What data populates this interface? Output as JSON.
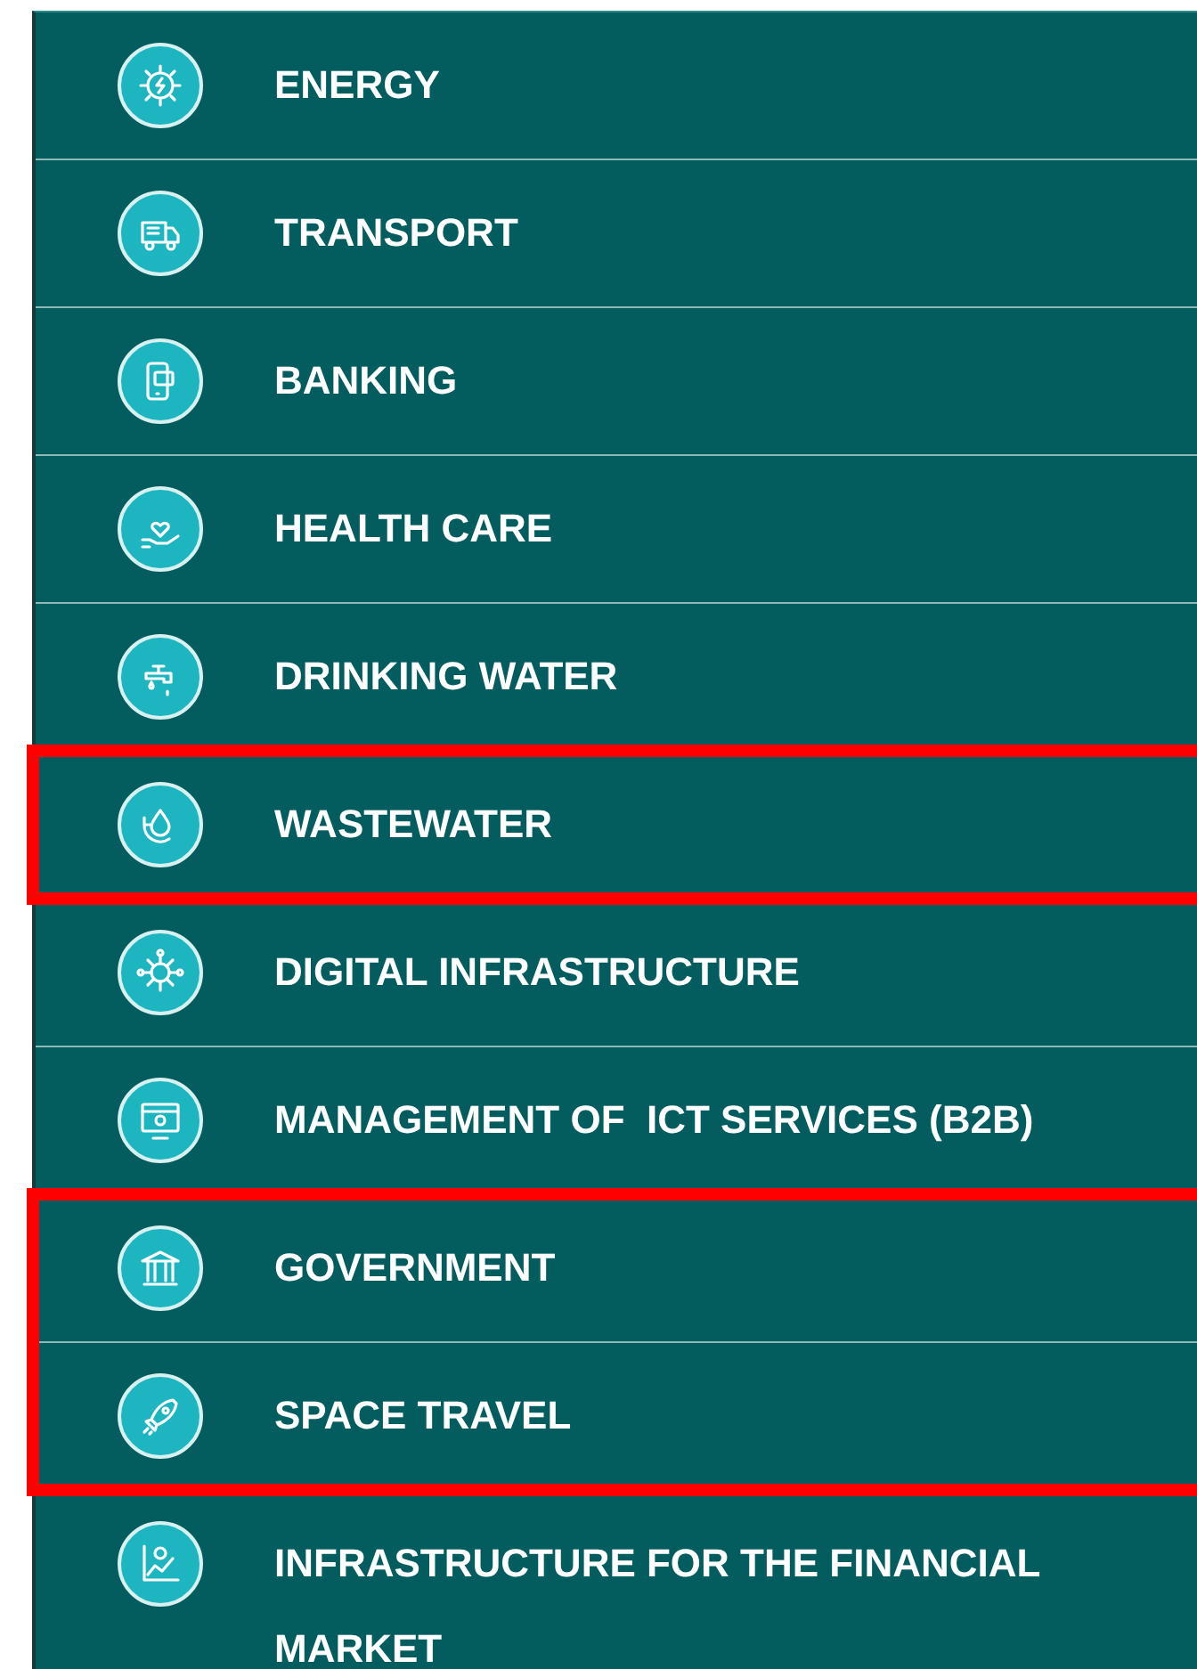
{
  "sectors": [
    {
      "label": "ENERGY",
      "highlighted": false
    },
    {
      "label": "TRANSPORT",
      "highlighted": false
    },
    {
      "label": "BANKING",
      "highlighted": false
    },
    {
      "label": "HEALTH CARE",
      "highlighted": false
    },
    {
      "label": "DRINKING WATER",
      "highlighted": false
    },
    {
      "label": "WASTEWATER",
      "highlighted": true
    },
    {
      "label": "DIGITAL INFRASTRUCTURE",
      "highlighted": false
    },
    {
      "label": "MANAGEMENT OF  ICT SERVICES (B2B)",
      "highlighted": false
    },
    {
      "label": "GOVERNMENT",
      "highlighted": true
    },
    {
      "label": "SPACE TRAVEL",
      "highlighted": true
    },
    {
      "label": "INFRASTRUCTURE FOR THE FINANCIAL MARKET",
      "highlighted": false
    }
  ]
}
